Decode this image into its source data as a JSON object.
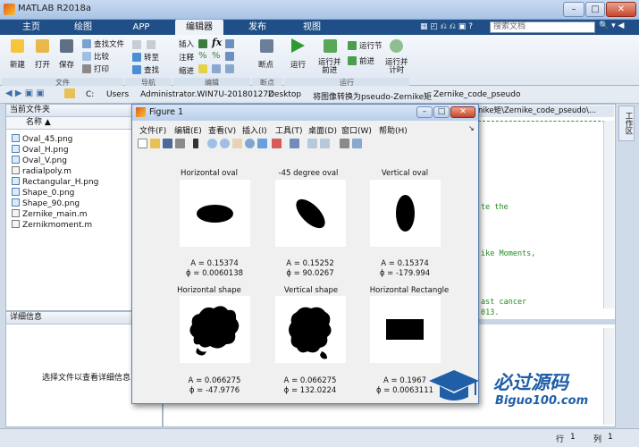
{
  "window": {
    "title": "MATLAB R2018a"
  },
  "tabs": [
    "主页",
    "绘图",
    "APP",
    "编辑器",
    "发布",
    "视图"
  ],
  "search": {
    "placeholder": "搜索文档"
  },
  "ribbon": {
    "file": {
      "new": "新建",
      "open": "打开",
      "save": "保存",
      "find_files": "查找文件",
      "compare": "比较",
      "print": "打印",
      "group": "文件"
    },
    "nav": {
      "goto": "转至",
      "find": "查找",
      "group": "导航"
    },
    "edit": {
      "insert": "插入",
      "comment": "注释",
      "indent": "缩进",
      "group": "编辑"
    },
    "breakpoints": {
      "label": "断点",
      "group": "断点"
    },
    "run": {
      "run": "运行",
      "run_advance": "运行并\n前进",
      "run_section": "运行节",
      "advance": "前进",
      "run_time": "运行并\n计时",
      "group": "运行"
    }
  },
  "address": {
    "path": [
      "C:",
      "Users",
      "Administrator.WIN7U-20180127Z",
      "Desktop",
      "将图像转换为pseudo-Zernike矩",
      "Zernike_code_pseudo"
    ],
    "right_path": "nike矩\\Zernike_code_pseudo\\..."
  },
  "file_browser": {
    "title": "当前文件夹",
    "column": "名称 ▲",
    "files": [
      "Oval_45.png",
      "Oval_H.png",
      "Oval_V.png",
      "radialpoly.m",
      "Rectangular_H.png",
      "Shape_0.png",
      "Shape_90.png",
      "Zernike_main.m",
      "Zernikmoment.m"
    ]
  },
  "details": {
    "title": "详细信息",
    "hint": "选择文件以查看详细信息"
  },
  "side_tab": "工作区",
  "editor_snippets": [
    "te the",
    "ike Moments,",
    "ast cancer",
    "013."
  ],
  "figure": {
    "title": "Figure 1",
    "menu": [
      "文件(F)",
      "编辑(E)",
      "查看(V)",
      "插入(I)",
      "工具(T)",
      "桌面(D)",
      "窗口(W)",
      "帮助(H)"
    ],
    "plots": [
      {
        "title": "Horizontal oval",
        "A": "A = 0.15374",
        "phi": "ϕ = 0.0060138"
      },
      {
        "title": "-45 degree oval",
        "A": "A = 0.15252",
        "phi": "ϕ = 90.0267"
      },
      {
        "title": "Vertical oval",
        "A": "A = 0.15374",
        "phi": "ϕ = -179.994"
      },
      {
        "title": "Horizontal shape",
        "A": "A = 0.066275",
        "phi": "ϕ = -47.9776"
      },
      {
        "title": "Vertical shape",
        "A": "A = 0.066275",
        "phi": "ϕ = 132.0224"
      },
      {
        "title": "Horizontal Rectangle",
        "A": "A = 0.1967",
        "phi": "ϕ = 0.0063111"
      }
    ]
  },
  "status": {
    "row_label": "行",
    "row": "1",
    "col_label": "列",
    "col": "1"
  },
  "watermark": {
    "title": "必过源码",
    "url": "Biguo100.com"
  }
}
